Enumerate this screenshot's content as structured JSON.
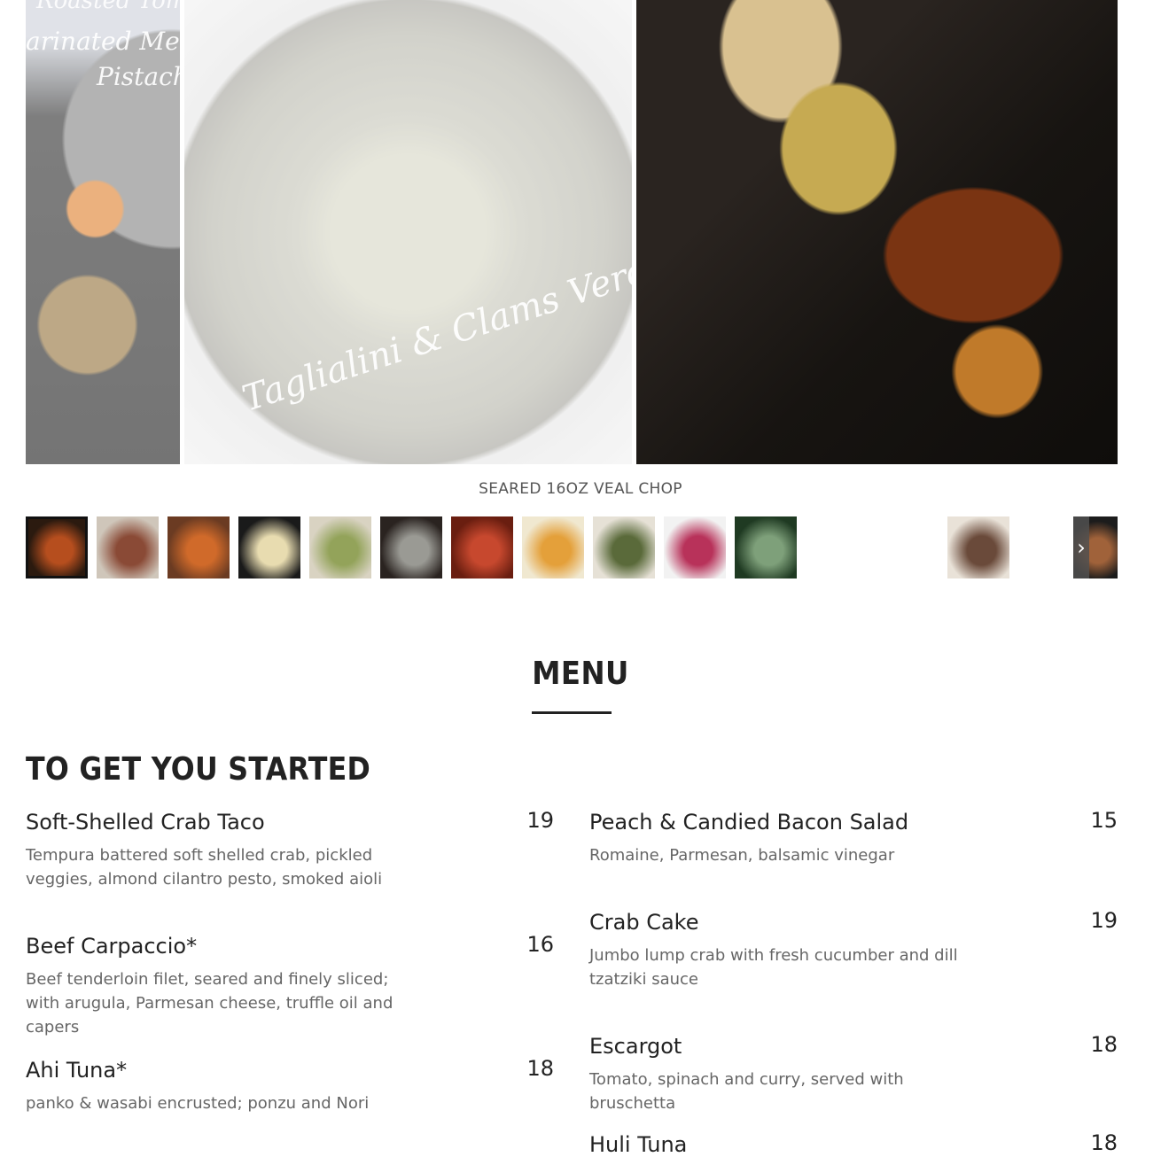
{
  "gallery": {
    "prev_slide_text": [
      "Roasted Tomato",
      "arinated Melon",
      "Pistachio"
    ],
    "current_slide_text": "Taglialini & Clams Verde",
    "caption": "SEARED 16OZ VEAL CHOP",
    "next_arrow_icon": "chevron-right-icon",
    "thumbnails": [
      {
        "colors": [
          "#2b1a0f",
          "#b64e1e"
        ]
      },
      {
        "colors": [
          "#cfc6ba",
          "#8a4a36"
        ]
      },
      {
        "colors": [
          "#6b3b22",
          "#d06a2a"
        ]
      },
      {
        "colors": [
          "#1a1a1a",
          "#e8dcb0"
        ]
      },
      {
        "colors": [
          "#d9d3c2",
          "#93a35a"
        ]
      },
      {
        "colors": [
          "#2a2320",
          "#9a9a94"
        ]
      },
      {
        "colors": [
          "#6a1e10",
          "#c7482e"
        ]
      },
      {
        "colors": [
          "#f0e8d0",
          "#e4a03a"
        ]
      },
      {
        "colors": [
          "#e6e1d6",
          "#5a6a3a"
        ]
      },
      {
        "colors": [
          "#f2f2f2",
          "#b8325a"
        ]
      },
      {
        "colors": [
          "#1f3a22",
          "#7ea07a"
        ]
      },
      {
        "colors": [
          "#e9e2d8",
          "#6a4a3a"
        ]
      },
      {
        "colors": [
          "#1c1c1c",
          "#a0623a"
        ]
      }
    ]
  },
  "menu": {
    "title": "MENU",
    "section_title": "TO GET YOU STARTED",
    "left_items": [
      {
        "name": "Soft-Shelled Crab Taco",
        "price": "19",
        "desc": "Tempura battered soft shelled crab, pickled veggies, almond cilantro pesto, smoked aioli"
      },
      {
        "name": "Beef Carpaccio*",
        "price": "16",
        "desc": "Beef tenderloin filet, seared and finely sliced; with arugula, Parmesan cheese, truffle oil and capers"
      },
      {
        "name": "Ahi Tuna*",
        "price": "18",
        "desc": "panko & wasabi encrusted; ponzu and Nori"
      }
    ],
    "right_items": [
      {
        "name": "Peach & Candied Bacon Salad",
        "price": "15",
        "desc": "Romaine, Parmesan, balsamic vinegar"
      },
      {
        "name": "Crab Cake",
        "price": "19",
        "desc": "Jumbo lump crab with fresh cucumber and dill tzatziki sauce"
      },
      {
        "name": "Escargot",
        "price": "18",
        "desc": "Tomato, spinach and curry, served with bruschetta"
      },
      {
        "name": "Huli Tuna",
        "price": "18",
        "desc": ""
      }
    ]
  }
}
